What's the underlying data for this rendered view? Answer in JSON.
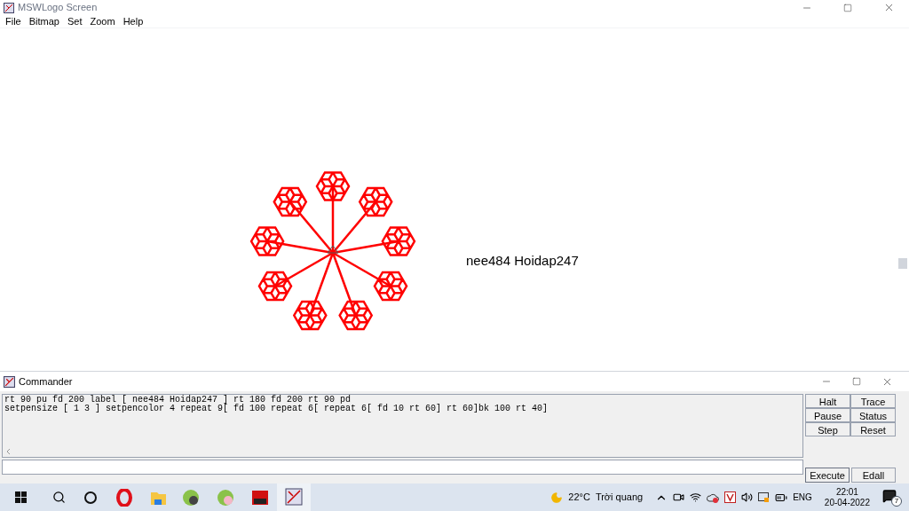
{
  "window": {
    "title": "MSWLogo Screen"
  },
  "menu": [
    "File",
    "Bitmap",
    "Set",
    "Zoom",
    "Help"
  ],
  "canvas": {
    "label": "nee484 Hoidap247"
  },
  "commander": {
    "title": "Commander",
    "history": [
      "rt 90 pu fd 200 label [ nee484 Hoidap247 ] rt 180 fd 200 rt 90 pd",
      "setpensize [ 1 3 ] setpencolor 4 repeat 9[ fd 100 repeat 6[ repeat 6[ fd 10 rt 60] rt 60]bk 100 rt 40]"
    ],
    "buttons": [
      "Halt",
      "Trace",
      "Pause",
      "Status",
      "Step",
      "Reset"
    ],
    "execute": "Execute",
    "edall": "Edall"
  },
  "taskbar": {
    "weather": "22°C",
    "weather_text": "Trời quang",
    "language": "ENG",
    "time": "22:01",
    "date": "20-04-2022",
    "notifications": "7"
  }
}
